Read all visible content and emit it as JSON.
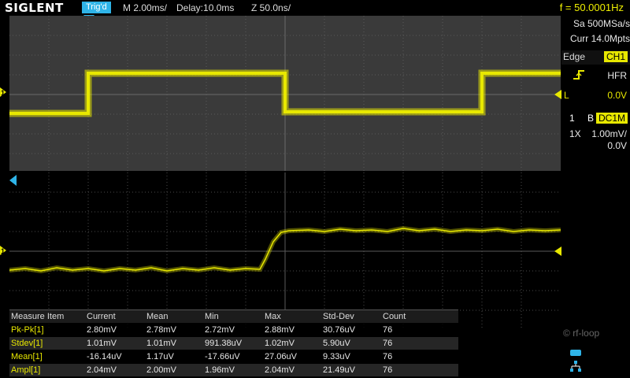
{
  "header": {
    "brand": "SIGLENT",
    "trigger_status": "Trig'd",
    "timebase": "M 2.00ms/",
    "delay": "Delay:10.0ms",
    "zoom": "Z 50.0ns/",
    "frequency": "f = 50.0001Hz"
  },
  "acquisition": {
    "sample_rate": "Sa 500MSa/s",
    "memory_depth": "Curr 14.0Mpts"
  },
  "trigger": {
    "type": "Edge",
    "source": "CH1",
    "slope_icon": "rising-edge-icon",
    "coupling": "HFR",
    "level_label": "L",
    "level_value": "0.0V"
  },
  "channel": {
    "number": "1",
    "bw_flag": "B",
    "coupling": "DC1M",
    "probe": "1X",
    "scale": "1.00mV/",
    "offset": "0.0V",
    "marker_label": "1",
    "color": "#e8e800"
  },
  "measure": {
    "headers": [
      "Measure Item",
      "Current",
      "Mean",
      "Min",
      "Max",
      "Std-Dev",
      "Count"
    ],
    "rows": [
      [
        "Pk-Pk[1]",
        "2.80mV",
        "2.78mV",
        "2.72mV",
        "2.88mV",
        "30.76uV",
        "76"
      ],
      [
        "Stdev[1]",
        "1.01mV",
        "1.01mV",
        "991.38uV",
        "1.02mV",
        "5.90uV",
        "76"
      ],
      [
        "Mean[1]",
        "-16.14uV",
        "1.17uV",
        "-17.66uV",
        "27.06uV",
        "9.33uV",
        "76"
      ],
      [
        "Ampl[1]",
        "2.04mV",
        "2.00mV",
        "1.96mV",
        "2.04mV",
        "21.49uV",
        "76"
      ]
    ]
  },
  "watermark": "rf-loop",
  "colors": {
    "accent": "#2fb4e8",
    "trace": "#e8e800"
  }
}
